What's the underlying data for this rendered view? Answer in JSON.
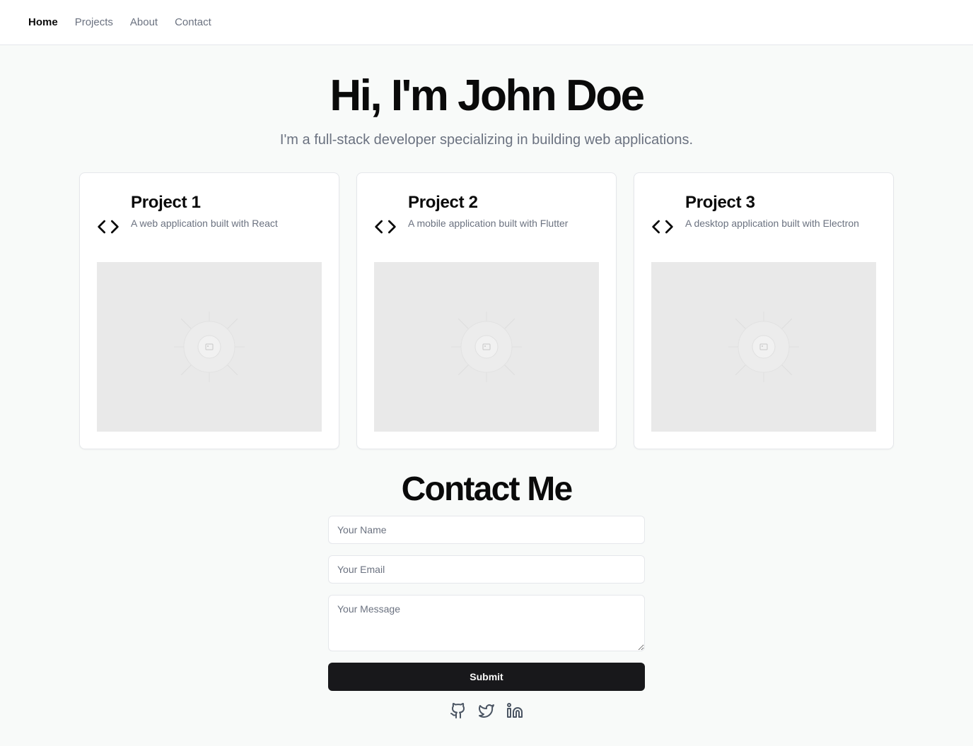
{
  "nav": {
    "items": [
      {
        "label": "Home",
        "active": true
      },
      {
        "label": "Projects",
        "active": false
      },
      {
        "label": "About",
        "active": false
      },
      {
        "label": "Contact",
        "active": false
      }
    ]
  },
  "hero": {
    "title": "Hi, I'm John Doe",
    "subtitle": "I'm a full-stack developer specializing in building web applications."
  },
  "projects": [
    {
      "title": "Project 1",
      "description": "A web application built with React",
      "icon": "code-icon",
      "image": "image-placeholder-icon"
    },
    {
      "title": "Project 2",
      "description": "A mobile application built with Flutter",
      "icon": "code-icon",
      "image": "image-placeholder-icon"
    },
    {
      "title": "Project 3",
      "description": "A desktop application built with Electron",
      "icon": "code-icon",
      "image": "image-placeholder-icon"
    }
  ],
  "contact": {
    "title": "Contact Me",
    "name_placeholder": "Your Name",
    "email_placeholder": "Your Email",
    "message_placeholder": "Your Message",
    "submit_label": "Submit"
  },
  "socials": [
    {
      "icon": "github-icon"
    },
    {
      "icon": "twitter-icon"
    },
    {
      "icon": "linkedin-icon"
    }
  ],
  "colors": {
    "background": "#f8faf9",
    "primary_button": "#18181b",
    "muted_text": "#6b7280",
    "border": "#e5e7eb",
    "placeholder_bg": "#e9e9e9"
  }
}
